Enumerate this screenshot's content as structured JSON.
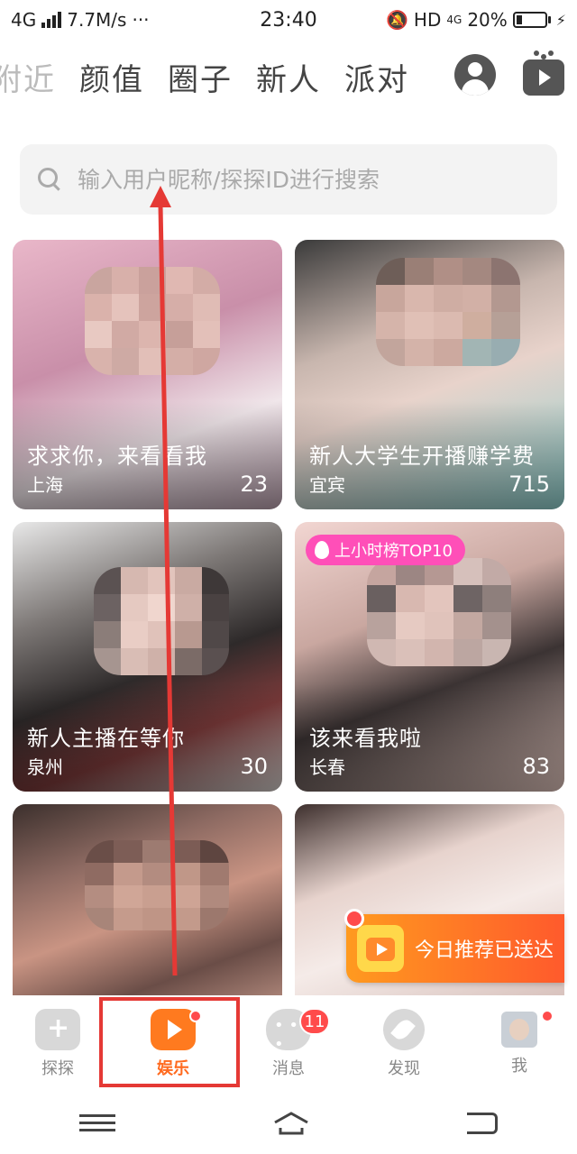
{
  "status_bar": {
    "network": "4G",
    "speed": "7.7M/s",
    "dots": "···",
    "time": "23:40",
    "hd": "HD",
    "net_small": "4G",
    "battery": "20%"
  },
  "tabs": [
    {
      "label": "附近"
    },
    {
      "label": "颜值"
    },
    {
      "label": "圈子"
    },
    {
      "label": "新人"
    },
    {
      "label": "派对"
    }
  ],
  "search": {
    "placeholder": "输入用户昵称/探探ID进行搜索"
  },
  "cards": [
    {
      "title": "求求你，来看看我",
      "city": "上海",
      "count": "23",
      "bg": "#d6a9bd",
      "hot_badge": ""
    },
    {
      "title": "新人大学生开播赚学费",
      "city": "宜宾",
      "count": "715",
      "bg": "#b8c8c3",
      "hot_badge": ""
    },
    {
      "title": "新人主播在等你",
      "city": "泉州",
      "count": "30",
      "bg": "#6d6a6b",
      "hot_badge": ""
    },
    {
      "title": "该来看我啦",
      "city": "长春",
      "count": "83",
      "bg": "#c9a99f",
      "hot_badge": "上小时榜TOP10"
    },
    {
      "title": "",
      "city": "",
      "count": "",
      "bg": "#8b6d66",
      "hot_badge": ""
    },
    {
      "title": "",
      "city": "",
      "count": "",
      "bg": "#d9c9c6",
      "hot_badge": ""
    }
  ],
  "toast": {
    "label": "今日推荐已送达"
  },
  "bottom_nav": [
    {
      "label": "探探",
      "icon": "tantan-icon"
    },
    {
      "label": "娱乐",
      "icon": "entertainment-icon"
    },
    {
      "label": "消息",
      "icon": "message-icon",
      "badge": "11"
    },
    {
      "label": "发现",
      "icon": "discover-icon"
    },
    {
      "label": "我",
      "icon": "profile-avatar"
    }
  ],
  "colors": {
    "accent": "#ff6a1f",
    "badge_red": "#ff4b4b",
    "annotation_red": "#e53935"
  }
}
